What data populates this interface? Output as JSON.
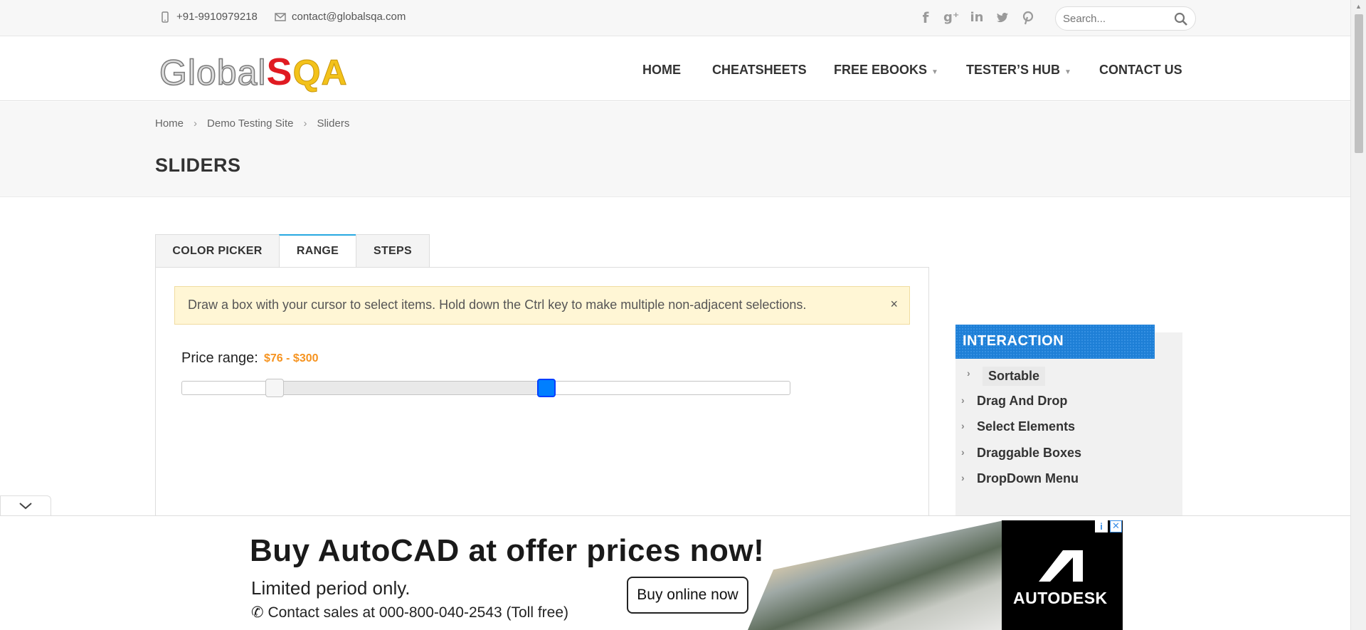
{
  "topbar": {
    "phone": "+91-9910979218",
    "email": "contact@globalsqa.com",
    "social": [
      "facebook-icon",
      "google-plus-icon",
      "linkedin-icon",
      "twitter-icon",
      "pinterest-icon"
    ],
    "search_placeholder": "Search..."
  },
  "logo": {
    "part1": "Global",
    "part2": "S",
    "part3": "QA"
  },
  "nav": {
    "home": "HOME",
    "cheatsheets": "CHEATSHEETS",
    "ebooks": "FREE EBOOKS",
    "testers_hub": "TESTER’S HUB",
    "contact": "CONTACT US"
  },
  "breadcrumb": {
    "home": "Home",
    "demo": "Demo Testing Site",
    "current": "Sliders",
    "sep": "›"
  },
  "page_title": "SLIDERS",
  "tabs": [
    "COLOR PICKER",
    "RANGE",
    "STEPS"
  ],
  "active_tab": "RANGE",
  "alert": {
    "text": "Draw a box with your cursor to select items. Hold down the Ctrl key to make multiple non-adjacent selections.",
    "close": "×"
  },
  "slider": {
    "label": "Price range:",
    "value_text": "$76 - $300",
    "min": 0,
    "max": 500,
    "low": 76,
    "high": 300
  },
  "sidebar": {
    "heading": "INTERACTION",
    "items": [
      "Sortable",
      "Drag And Drop",
      "Select Elements",
      "Draggable Boxes",
      "DropDown Menu"
    ]
  },
  "ad": {
    "headline": "Buy AutoCAD at offer prices now!",
    "subline": "Limited period only.",
    "contact": "Contact sales at 000-800-040-2543 (Toll free)",
    "button": "Buy online now",
    "brand": "AUTODESK",
    "info": "i",
    "close": "✕"
  },
  "colors": {
    "accent": "#27a9e1",
    "value": "#f6931f",
    "handle_active": "#007fff",
    "sidebar_head": "#1e7fd6",
    "alert_bg": "#fff6d5"
  }
}
